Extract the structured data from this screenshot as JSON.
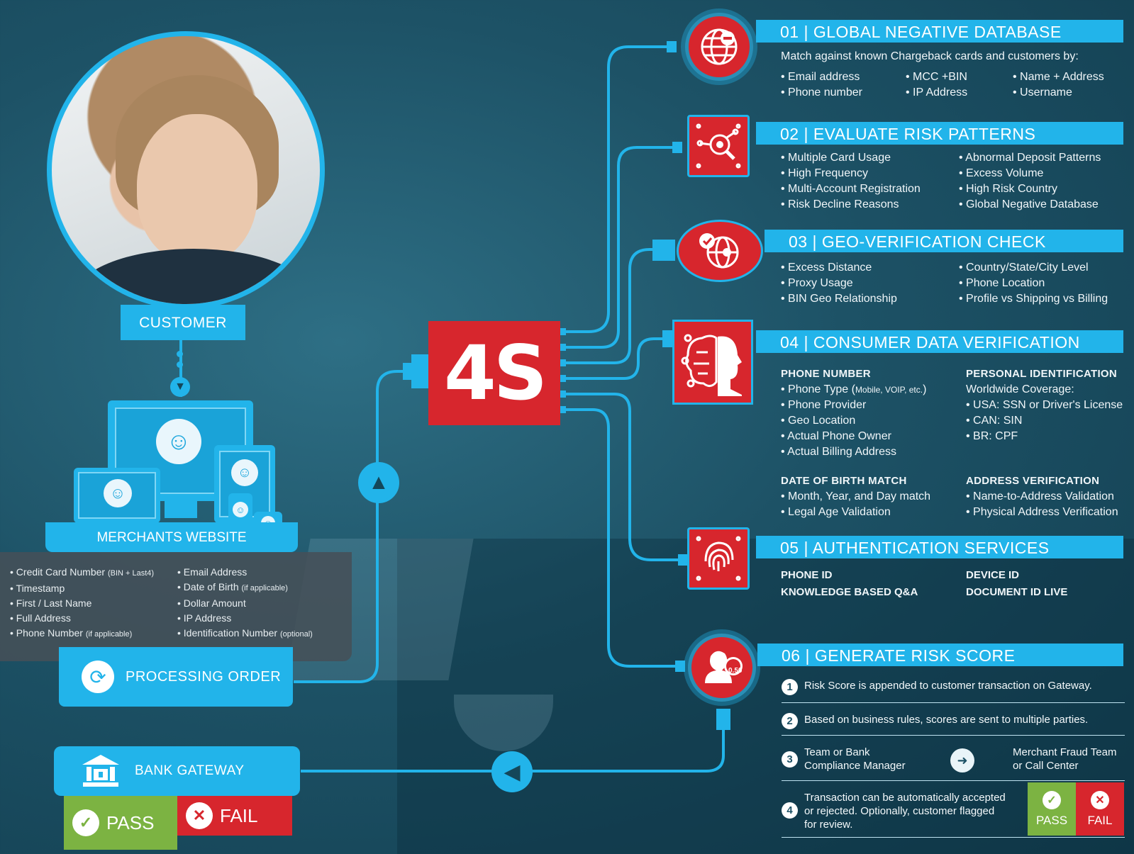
{
  "left": {
    "customer_label": "CUSTOMER",
    "merchant_label": "MERCHANTS WEBSITE",
    "info_col1": [
      {
        "text": "• Credit Card Number ",
        "small": "(BIN + Last4)"
      },
      {
        "text": "• Timestamp",
        "small": ""
      },
      {
        "text": "• First / Last Name",
        "small": ""
      },
      {
        "text": "• Full Address",
        "small": ""
      },
      {
        "text": "• Phone Number ",
        "small": "(if applicable)"
      }
    ],
    "info_col2": [
      {
        "text": "• Email Address",
        "small": ""
      },
      {
        "text": "• Date of Birth  ",
        "small": "(if applicable)"
      },
      {
        "text": "• Dollar Amount",
        "small": ""
      },
      {
        "text": "• IP Address",
        "small": ""
      },
      {
        "text": "• Identification Number ",
        "small": "(optional)"
      }
    ],
    "processing_label": "PROCESSING ORDER",
    "bank_label": "BANK GATEWAY",
    "pass_label": "PASS",
    "fail_label": "FAIL"
  },
  "hub": {
    "label": "4S",
    "color": "#d7262d"
  },
  "sections": {
    "s1": {
      "title": "01  |  GLOBAL NEGATIVE DATABASE",
      "intro": "Match against known Chargeback cards and customers by:",
      "cols": [
        [
          "• Email address",
          "• Phone number"
        ],
        [
          "• MCC +BIN",
          "• IP Address"
        ],
        [
          "• Name + Address",
          "• Username"
        ]
      ],
      "icon": "globe-minus-icon"
    },
    "s2": {
      "title": "02  |  EVALUATE RISK PATTERNS",
      "cols": [
        [
          "• Multiple Card Usage",
          "• High Frequency",
          "• Multi-Account Registration",
          "• Risk Decline Reasons"
        ],
        [
          "• Abnormal Deposit Patterns",
          "• Excess Volume",
          "• High Risk Country",
          "• Global Negative Database"
        ]
      ],
      "icon": "magnifier-network-icon"
    },
    "s3": {
      "title": "03  |  GEO-VERIFICATION CHECK",
      "cols": [
        [
          "• Excess Distance",
          "• Proxy Usage",
          "• BIN Geo Relationship"
        ],
        [
          "• Country/State/City Level",
          "• Phone Location",
          "• Profile vs Shipping vs Billing"
        ]
      ],
      "icon": "globe-pin-icon"
    },
    "s4": {
      "title": "04  |  CONSUMER DATA VERIFICATION",
      "phone_head": "PHONE NUMBER",
      "phone_type": "• Phone Type (",
      "phone_type_small": "Mobile, VOIP, etc.",
      "phone_type_end": ")",
      "phone_items": [
        "• Phone Provider",
        "• Geo Location",
        "• Actual Phone Owner",
        "• Actual Billing Address"
      ],
      "pid_head": "PERSONAL IDENTIFICATION",
      "pid_items": [
        "Worldwide Coverage:",
        "• USA: SSN or Driver's License",
        "• CAN: SIN",
        "• BR: CPF"
      ],
      "dob_head": "DATE OF BIRTH MATCH",
      "dob_items": [
        "• Month, Year, and Day match",
        "• Legal Age Validation"
      ],
      "addr_head": "ADDRESS VERIFICATION",
      "addr_items": [
        "• Name-to-Address Validation",
        "• Physical Address Verification"
      ],
      "icon": "brain-head-icon"
    },
    "s5": {
      "title": "05  |  AUTHENTICATION SERVICES",
      "col1": [
        "PHONE ID",
        "KNOWLEDGE BASED Q&A"
      ],
      "col2": [
        "DEVICE ID",
        "DOCUMENT ID LIVE"
      ],
      "icon": "fingerprint-icon"
    },
    "s6": {
      "title": "06  |  GENERATE RISK SCORE",
      "badge_value": "0.50",
      "rows": [
        {
          "n": "1",
          "text": "Risk Score is appended to customer transaction on Gateway."
        },
        {
          "n": "2",
          "text": "Based on business rules, scores are sent to multiple parties."
        },
        {
          "n": "3",
          "left": [
            "Team or Bank",
            "Compliance Manager"
          ],
          "right": [
            "Merchant Fraud Team",
            "or Call Center"
          ]
        },
        {
          "n": "4",
          "lines": [
            "Transaction can be automatically accepted",
            "or rejected. Optionally, customer flagged",
            "for review."
          ]
        }
      ],
      "pass_label": "PASS",
      "fail_label": "FAIL",
      "icon": "user-score-icon"
    }
  },
  "colors": {
    "accent": "#22b4ea",
    "red": "#d7262d",
    "green": "#7cb342"
  }
}
